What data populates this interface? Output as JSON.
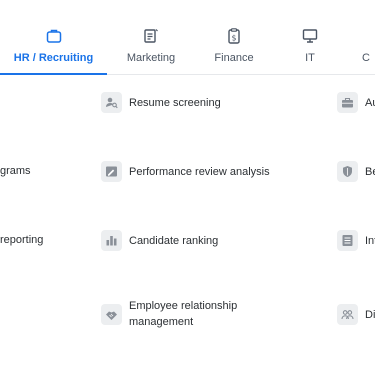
{
  "tabs": [
    {
      "label": "HR / Recruiting",
      "icon": "briefcase-icon",
      "active": true
    },
    {
      "label": "Marketing",
      "icon": "edit-document-icon"
    },
    {
      "label": "Finance",
      "icon": "dollar-clipboard-icon"
    },
    {
      "label": "IT",
      "icon": "monitor-icon"
    },
    {
      "label": "C",
      "icon": ""
    }
  ],
  "left_column": [
    "grams",
    "reporting"
  ],
  "middle_column": [
    {
      "label": "Resume screening",
      "icon": "user-search-icon"
    },
    {
      "label": "Performance review analysis",
      "icon": "edit-chart-icon"
    },
    {
      "label": "Candidate ranking",
      "icon": "bar-chart-icon"
    },
    {
      "label_line1": "Employee relationship",
      "label_line2": "management",
      "icon": "handshake-icon"
    }
  ],
  "right_column": [
    {
      "label": "Au",
      "icon": "briefcase-icon"
    },
    {
      "label": "Be",
      "icon": "shield-icon"
    },
    {
      "label": "Int",
      "icon": "contact-card-icon"
    },
    {
      "label": "Div",
      "icon": "group-icon"
    }
  ],
  "colors": {
    "accent": "#1a73e8",
    "badge_bg": "#eceef0",
    "icon_gray": "#8a9098"
  }
}
